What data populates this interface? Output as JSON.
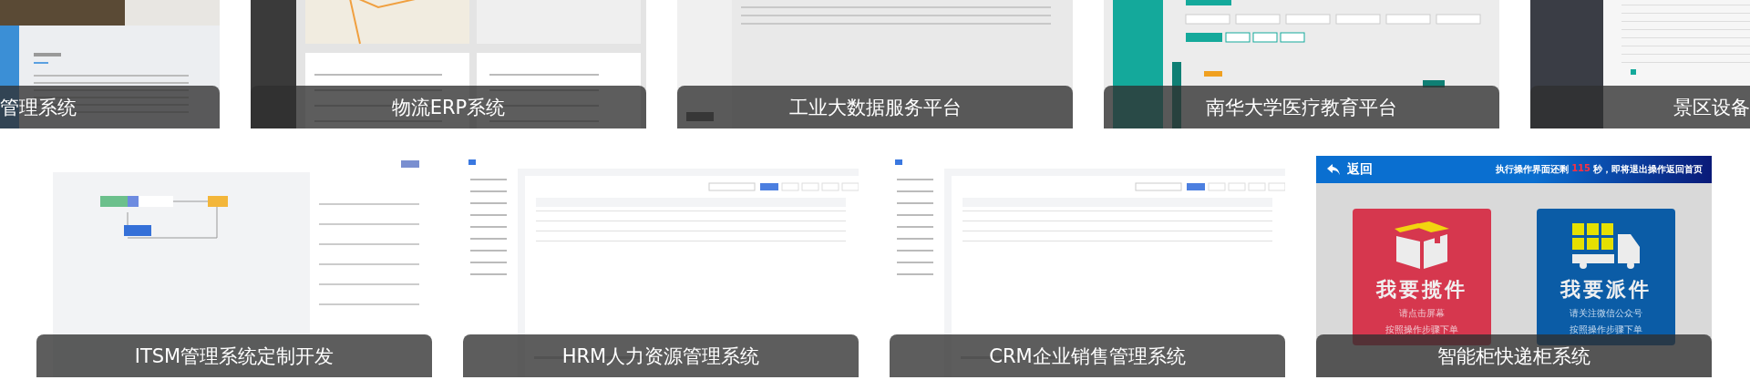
{
  "top_row": [
    {
      "caption": "管理系统",
      "kind": "website"
    },
    {
      "caption": "物流ERP系统",
      "kind": "dark-dashboard"
    },
    {
      "caption": "工业大数据服务平台",
      "kind": "table-app"
    },
    {
      "caption": "南华大学医疗教育平台",
      "kind": "teal-admin"
    },
    {
      "caption": "景区设备",
      "kind": "dark-table"
    }
  ],
  "bottom_row": [
    {
      "caption": "ITSM管理系统定制开发",
      "kind": "workflow"
    },
    {
      "caption": "HRM人力资源管理系统",
      "kind": "admin-table"
    },
    {
      "caption": "CRM企业销售管理系统",
      "kind": "admin-table"
    },
    {
      "caption": "智能柜快递柜系统",
      "kind": "locker",
      "locker": {
        "back": "返回",
        "timer_prefix": "执行操作界面还剩",
        "countdown": "115",
        "timer_suffix": "秒，即将退出操作返回首页",
        "tiles": [
          {
            "kind": "pickup",
            "title": "我要揽件",
            "lines": [
              "请点击屏幕",
              "按照操作步骤下单"
            ]
          },
          {
            "kind": "deliver",
            "title": "我要派件",
            "lines": [
              "请关注微信公众号",
              "按照操作步骤下单"
            ]
          }
        ]
      }
    }
  ]
}
